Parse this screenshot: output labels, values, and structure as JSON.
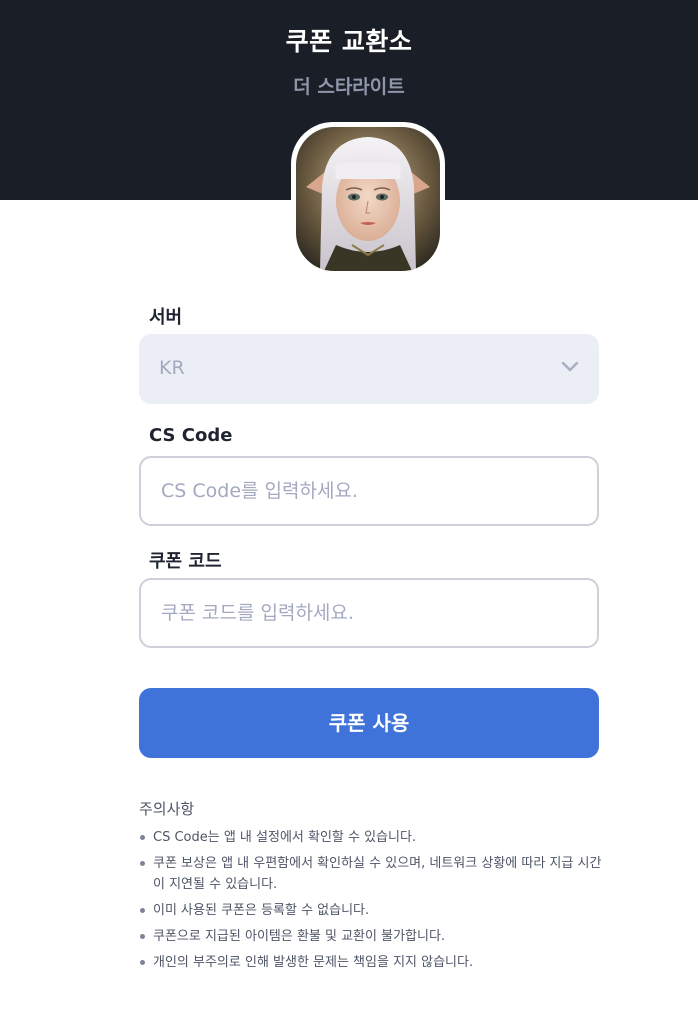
{
  "header": {
    "title": "쿠폰 교환소",
    "subtitle": "더 스타라이트",
    "background": "#1a1e27"
  },
  "game_icon": {
    "name": "game-character-icon"
  },
  "form": {
    "server": {
      "label": "서버",
      "selected": "KR",
      "icon": "chevron-down-icon"
    },
    "cs_code": {
      "label": "CS Code",
      "value": "",
      "placeholder": "CS Code를 입력하세요."
    },
    "coupon_code": {
      "label": "쿠폰 코드",
      "value": "",
      "placeholder": "쿠폰 코드를 입력하세요."
    },
    "submit_label": "쿠폰 사용",
    "accent": "#3f73d9"
  },
  "notice": {
    "title": "주의사항",
    "items": [
      "CS Code는 앱 내 설정에서 확인할 수 있습니다.",
      "쿠폰 보상은 앱 내 우편함에서 확인하실 수 있으며, 네트워크 상황에 따라 지급 시간이 지연될 수 있습니다.",
      "이미 사용된 쿠폰은 등록할 수 없습니다.",
      "쿠폰으로 지급된 아이템은 환불 및 교환이 불가합니다.",
      "개인의 부주의로 인해 발생한 문제는 책임을 지지 않습니다."
    ]
  }
}
